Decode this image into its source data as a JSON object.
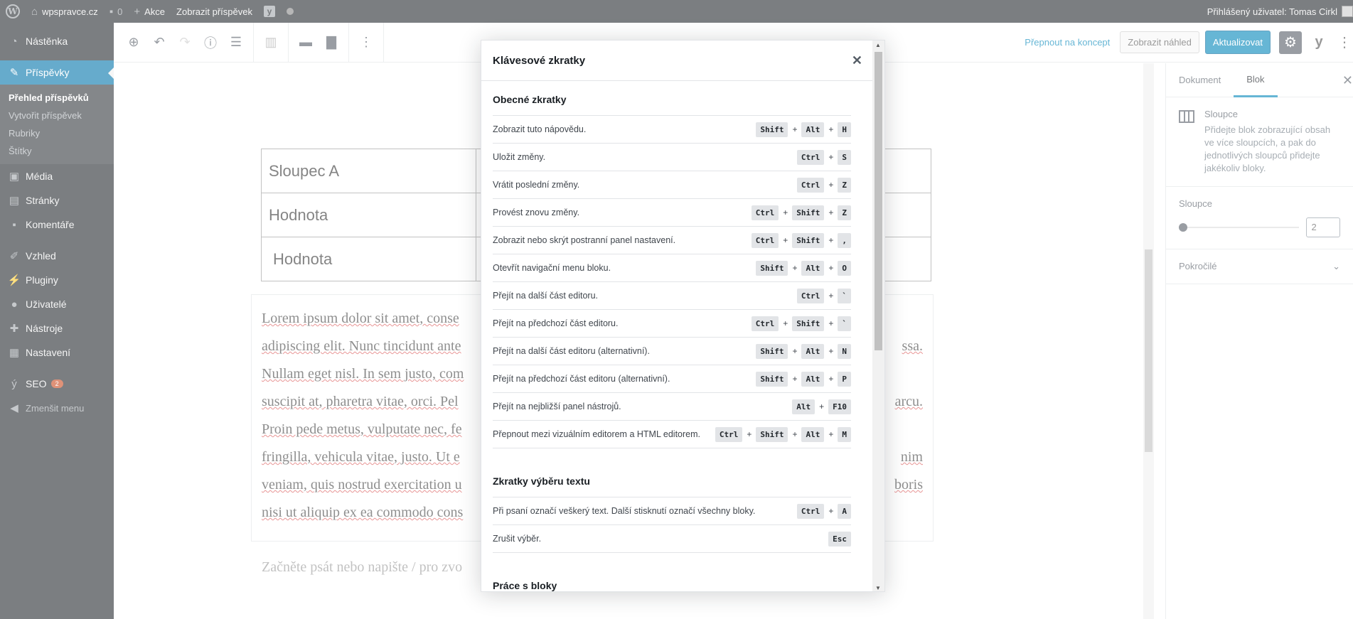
{
  "adminbar": {
    "site_name": "wpspravce.cz",
    "comments_count": "0",
    "new_label": "Akce",
    "view_post_label": "Zobrazit příspěvek",
    "yoast_glyph": "y",
    "user_label": "Přihlášený uživatel: Tomas Cirkl"
  },
  "sidebar": {
    "items": [
      {
        "label": "Nástěnka",
        "icon": "dashboard-icon"
      },
      {
        "label": "Příspěvky",
        "icon": "pin-icon"
      },
      {
        "label": "Média",
        "icon": "media-icon"
      },
      {
        "label": "Stránky",
        "icon": "pages-icon"
      },
      {
        "label": "Komentáře",
        "icon": "comments-icon"
      },
      {
        "label": "Vzhled",
        "icon": "appearance-icon"
      },
      {
        "label": "Pluginy",
        "icon": "plugins-icon"
      },
      {
        "label": "Uživatelé",
        "icon": "users-icon"
      },
      {
        "label": "Nástroje",
        "icon": "tools-icon"
      },
      {
        "label": "Nastavení",
        "icon": "settings-icon"
      },
      {
        "label": "SEO",
        "icon": "yoast-icon",
        "badge": "2"
      },
      {
        "label": "Zmenšit menu",
        "icon": "collapse-icon"
      }
    ],
    "submenu": [
      "Přehled příspěvků",
      "Vytvořit příspěvek",
      "Rubriky",
      "Štítky"
    ]
  },
  "toolbar": {
    "switch_draft": "Přepnout na koncept",
    "preview": "Zobrazit náhled",
    "update": "Aktualizovat",
    "yoast_glyph": "y"
  },
  "editor": {
    "table": [
      [
        "Sloupec A",
        ""
      ],
      [
        "Hodnota",
        ""
      ],
      [
        "Hodnota",
        ""
      ]
    ],
    "paragraph_lines": [
      "Lorem ipsum dolor sit amet, conse",
      "adipiscing elit. Nunc tincidunt ante",
      "Nullam eget nisl. In sem justo, com",
      "suscipit at, pharetra vitae, orci. Pel",
      "Proin pede metus, vulputate nec, fe",
      "fringilla, vehicula vitae, justo. Ut e",
      "veniam, quis nostrud exercitation u",
      "nisi ut aliquip ex ea commodo cons"
    ],
    "paragraph_right": [
      "",
      "ssa.",
      "",
      "arcu.",
      "",
      "nim",
      "boris",
      ""
    ],
    "placeholder": "Začněte psát nebo napište / pro zvo"
  },
  "settings": {
    "tabs": [
      "Dokument",
      "Blok"
    ],
    "block_title": "Sloupce",
    "block_desc": "Přidejte blok zobrazující obsah ve více sloupcích, a pak do jednotlivých sloupců přidejte jakékoliv bloky.",
    "columns_label": "Sloupce",
    "columns_value": "2",
    "columns_level": 0.0,
    "advanced": "Pokročilé"
  },
  "modal": {
    "title": "Klávesové zkratky",
    "sections": [
      {
        "title": "Obecné zkratky",
        "rows": [
          {
            "desc": "Zobrazit tuto nápovědu.",
            "keys": [
              "Shift",
              "Alt",
              "H"
            ]
          },
          {
            "desc": "Uložit změny.",
            "keys": [
              "Ctrl",
              "S"
            ]
          },
          {
            "desc": "Vrátit poslední změny.",
            "keys": [
              "Ctrl",
              "Z"
            ]
          },
          {
            "desc": "Provést znovu změny.",
            "keys": [
              "Ctrl",
              "Shift",
              "Z"
            ]
          },
          {
            "desc": "Zobrazit nebo skrýt postranní panel nastavení.",
            "keys": [
              "Ctrl",
              "Shift",
              ","
            ]
          },
          {
            "desc": "Otevřít navigační menu bloku.",
            "keys": [
              "Shift",
              "Alt",
              "O"
            ]
          },
          {
            "desc": "Přejít na další část editoru.",
            "keys": [
              "Ctrl",
              "`"
            ]
          },
          {
            "desc": "Přejít na předchozí část editoru.",
            "keys": [
              "Ctrl",
              "Shift",
              "`"
            ]
          },
          {
            "desc": "Přejít na další část editoru (alternativní).",
            "keys": [
              "Shift",
              "Alt",
              "N"
            ]
          },
          {
            "desc": "Přejít na předchozí část editoru (alternativní).",
            "keys": [
              "Shift",
              "Alt",
              "P"
            ]
          },
          {
            "desc": "Přejít na nejbližší panel nástrojů.",
            "keys": [
              "Alt",
              "F10"
            ]
          },
          {
            "desc": "Přepnout mezi vizuálním editorem a HTML editorem.",
            "keys": [
              "Ctrl",
              "Shift",
              "Alt",
              "M"
            ]
          }
        ]
      },
      {
        "title": "Zkratky výběru textu",
        "rows": [
          {
            "desc": "Při psaní označí veškerý text. Další stisknutí označí všechny bloky.",
            "keys": [
              "Ctrl",
              "A"
            ]
          },
          {
            "desc": "Zrušit výběr.",
            "keys": [
              "Esc"
            ]
          }
        ]
      },
      {
        "title": "Práce s bloky",
        "rows": []
      }
    ]
  },
  "colors": {
    "admin_dark": "#23282d",
    "accent": "#0073aa",
    "button_primary": "#0085ba",
    "badge": "#ca4a1f"
  }
}
